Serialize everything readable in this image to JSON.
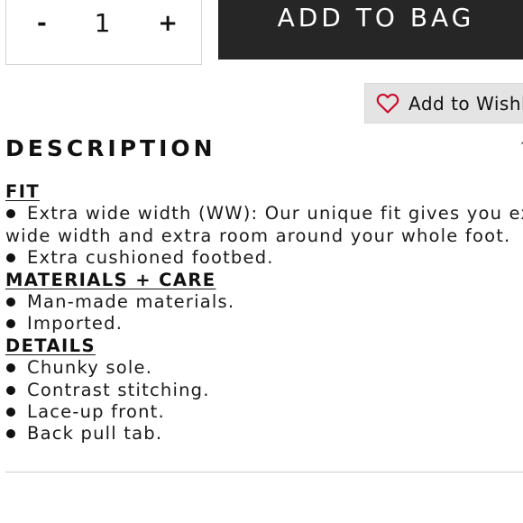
{
  "quantity": {
    "decrement_label": "-",
    "value": "1",
    "increment_label": "+"
  },
  "add_to_bag": {
    "label": "ADD TO BAG"
  },
  "wishlist": {
    "label": "Add to Wishlis",
    "icon": "heart-icon",
    "icon_color": "#c8102e"
  },
  "description": {
    "title": "DESCRIPTION",
    "edge_glyph": "^",
    "sections": {
      "fit": {
        "heading": "FIT",
        "items": [
          {
            "line1": "Extra wide width (WW): Our unique fit gives you ext",
            "line2": "wide width and extra room around your whole foot."
          },
          {
            "text": "Extra cushioned footbed."
          }
        ]
      },
      "materials": {
        "heading": "MATERIALS + CARE",
        "items": [
          "Man-made materials.",
          "Imported."
        ]
      },
      "details": {
        "heading": "DETAILS",
        "items": [
          "Chunky sole.",
          "Contrast stitching.",
          "Lace-up front.",
          "Back pull tab."
        ]
      }
    }
  },
  "colors": {
    "button_bg": "#262626",
    "wishlist_bg": "#e4e4e4",
    "text": "#111111"
  }
}
